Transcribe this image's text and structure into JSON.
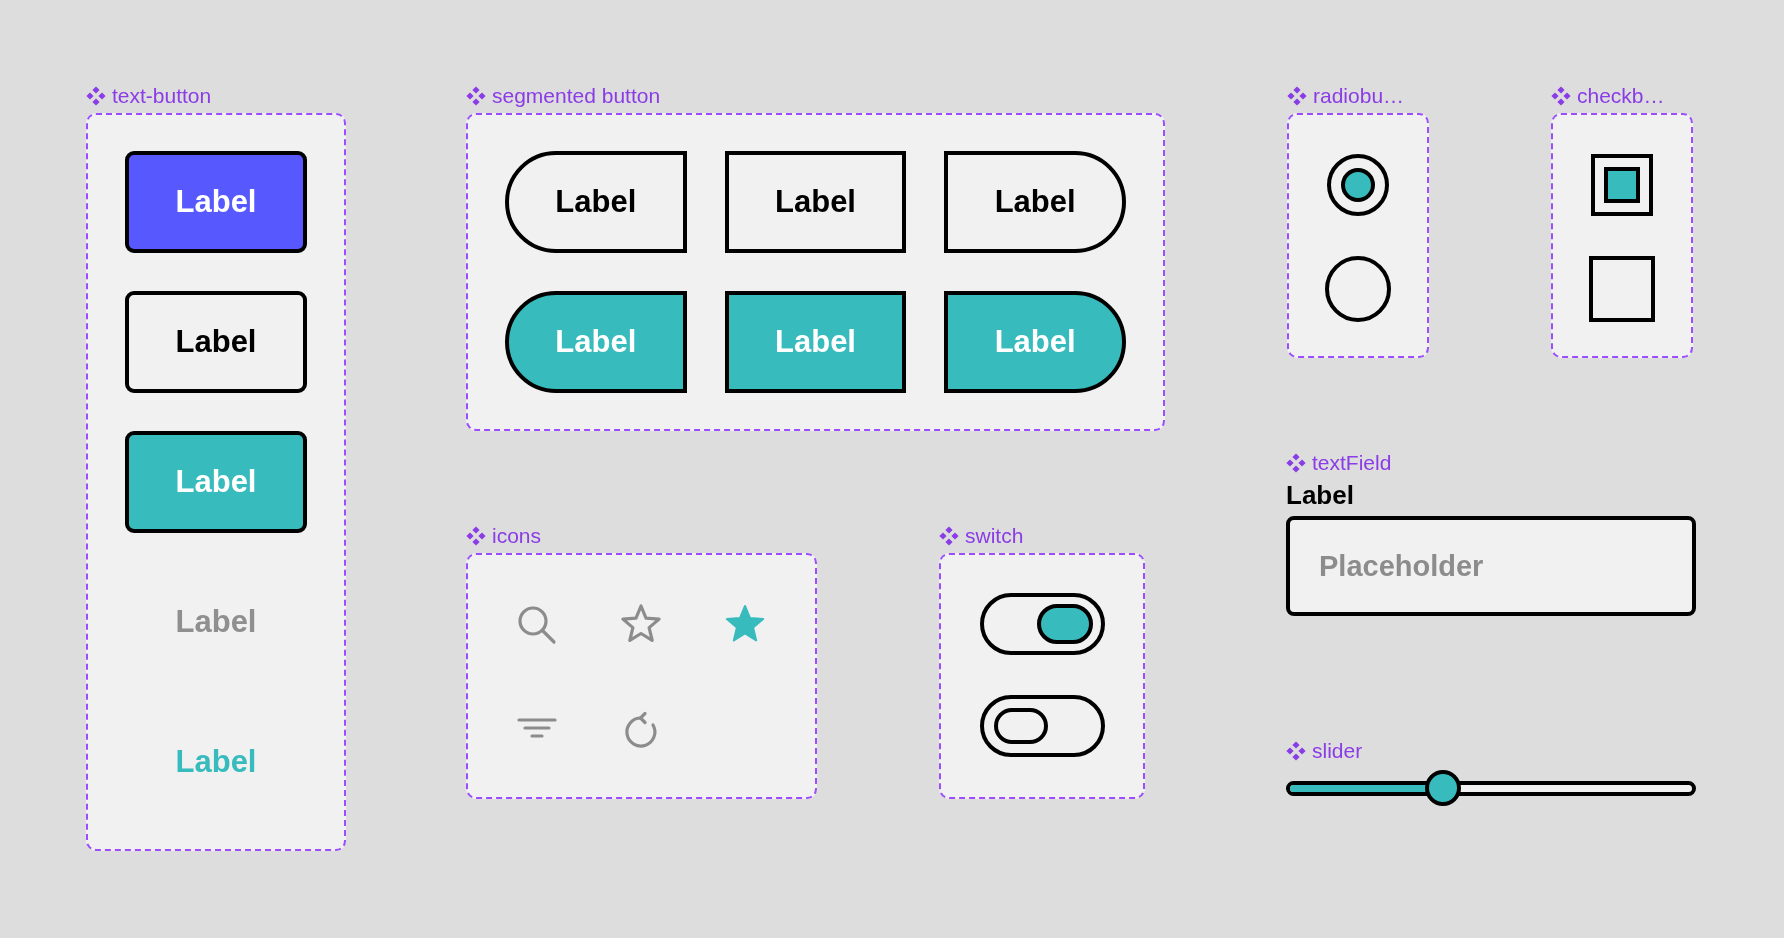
{
  "text_button": {
    "title": "text-button",
    "buttons": [
      {
        "kind": "primary",
        "label": "Label"
      },
      {
        "kind": "outlined",
        "label": "Label"
      },
      {
        "kind": "tonal",
        "label": "Label"
      },
      {
        "kind": "disabled",
        "label": "Label"
      },
      {
        "kind": "text",
        "label": "Label"
      }
    ]
  },
  "segmented_button": {
    "title": "segmented button",
    "rows": [
      {
        "segments": [
          {
            "label": "Label",
            "selected": false
          },
          {
            "label": "Label",
            "selected": false
          },
          {
            "label": "Label",
            "selected": false
          }
        ]
      },
      {
        "segments": [
          {
            "label": "Label",
            "selected": true
          },
          {
            "label": "Label",
            "selected": true
          },
          {
            "label": "Label",
            "selected": true
          }
        ]
      }
    ]
  },
  "radio_button": {
    "title": "radiobu…",
    "options": [
      {
        "selected": true
      },
      {
        "selected": false
      }
    ]
  },
  "checkbox": {
    "title": "checkb…",
    "boxes": [
      {
        "checked": true
      },
      {
        "checked": false
      }
    ]
  },
  "icons": {
    "title": "icons",
    "items": [
      {
        "kind": "search"
      },
      {
        "kind": "star"
      },
      {
        "kind": "star-filled"
      },
      {
        "kind": "filter"
      },
      {
        "kind": "refresh"
      }
    ]
  },
  "switch": {
    "title": "switch",
    "toggles": [
      {
        "on": true
      },
      {
        "on": false
      }
    ]
  },
  "text_field": {
    "title": "textField",
    "label": "Label",
    "placeholder": "Placeholder"
  },
  "slider": {
    "title": "slider",
    "level": 0.38
  }
}
